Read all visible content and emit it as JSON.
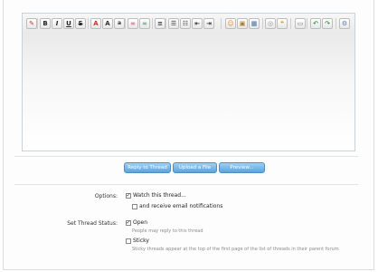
{
  "toolbar": {
    "buttons": [
      {
        "name": "remove-format-icon",
        "glyph": "✎",
        "color": "#c0392b"
      },
      {
        "name": "bold-icon",
        "glyph": "B",
        "color": "#222"
      },
      {
        "name": "italic-icon",
        "glyph": "I",
        "color": "#222"
      },
      {
        "name": "underline-icon",
        "glyph": "U",
        "color": "#222"
      },
      {
        "name": "strikethrough-icon",
        "glyph": "S",
        "color": "#222"
      },
      {
        "name": "font-color-icon",
        "glyph": "A",
        "color": "#c0392b"
      },
      {
        "name": "font-size-icon",
        "glyph": "A",
        "color": "#333"
      },
      {
        "name": "font-family-icon",
        "glyph": "a",
        "color": "#333"
      },
      {
        "name": "link-icon",
        "glyph": "∞",
        "color": "#d35f7a"
      },
      {
        "name": "unlink-icon",
        "glyph": "∞",
        "color": "#4fa36b"
      },
      {
        "name": "align-icon",
        "glyph": "≡",
        "color": "#333"
      },
      {
        "name": "bullet-list-icon",
        "glyph": "☰",
        "color": "#333"
      },
      {
        "name": "numbered-list-icon",
        "glyph": "☷",
        "color": "#333"
      },
      {
        "name": "outdent-icon",
        "glyph": "⇤",
        "color": "#333"
      },
      {
        "name": "indent-icon",
        "glyph": "⇥",
        "color": "#333"
      },
      {
        "name": "smilies-icon",
        "glyph": "☺",
        "color": "#e67e22"
      },
      {
        "name": "image-icon",
        "glyph": "▣",
        "color": "#b07a2c"
      },
      {
        "name": "media-icon",
        "glyph": "▦",
        "color": "#3f6fa5"
      },
      {
        "name": "code-icon",
        "glyph": "◎",
        "color": "#999"
      },
      {
        "name": "quote-icon",
        "glyph": "❝",
        "color": "#c9a227"
      },
      {
        "name": "save-draft-icon",
        "glyph": "▭",
        "color": "#777"
      },
      {
        "name": "undo-icon",
        "glyph": "↶",
        "color": "#3a9a4a"
      },
      {
        "name": "redo-icon",
        "glyph": "↷",
        "color": "#3a9a4a"
      },
      {
        "name": "toggle-editor-icon",
        "glyph": "⚙",
        "color": "#5a7fa8"
      }
    ]
  },
  "actions": {
    "reply": "Reply to Thread",
    "upload": "Upload a File",
    "preview": "Preview..."
  },
  "options": {
    "label": "Options:",
    "watch": "Watch this thread...",
    "watch_checked": "✓",
    "email": "and receive email notifications"
  },
  "status": {
    "label": "Set Thread Status:",
    "open": "Open",
    "open_checked": "✓",
    "open_hint": "People may reply to this thread",
    "sticky": "Sticky",
    "sticky_hint": "Sticky threads appear at the top of the first page of the list of threads in their parent forum"
  }
}
